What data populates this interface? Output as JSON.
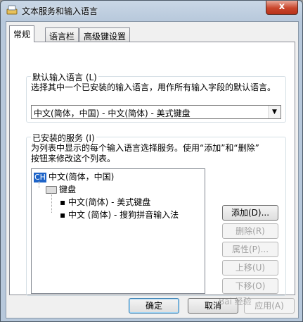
{
  "window": {
    "title": "文本服务和输入语言",
    "close_label": "x"
  },
  "tabs": [
    {
      "label": "常规",
      "active": true
    },
    {
      "label": "语言栏",
      "active": false
    },
    {
      "label": "高级键设置",
      "active": false
    }
  ],
  "default_language": {
    "title": "默认输入语言 (L)",
    "description": "选择其中一个已安装的输入语言，用作所有输入字段的默认语言。",
    "selected": "中文(简体，中国) - 中文(简体) - 美式键盘"
  },
  "installed_services": {
    "title": "已安装的服务 (I)",
    "description_line1": "为列表中显示的每个输入语言选择服务。使用“添加”和“删除”",
    "description_line2": "按钮来修改这个列表。",
    "tree": {
      "language_badge": "CH",
      "language": "中文(简体，中国)",
      "category": "键盘",
      "items": [
        "中文(简体) - 美式键盘",
        "中文 (简体) - 搜狗拼音输入法"
      ]
    },
    "buttons": {
      "add": "添加(D)...",
      "remove": "删除(R)",
      "properties": "属性(P)...",
      "move_up": "上移(U)",
      "move_down": "下移(O)"
    }
  },
  "footer": {
    "ok": "确定",
    "cancel": "取消",
    "apply": "应用(A)"
  },
  "watermark": "Bai 经验"
}
